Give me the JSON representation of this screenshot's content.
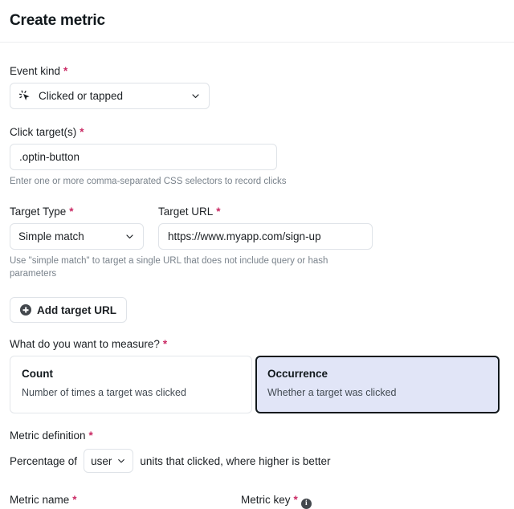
{
  "header": {
    "title": "Create metric"
  },
  "colors": {
    "required_asterisk": "#ca2a64",
    "selected_card_bg": "#e1e5f7",
    "selected_card_border": "#11181c",
    "border": "#dfe3e8",
    "text": "#1c2024",
    "helper_text": "#7a838c"
  },
  "fields": {
    "event_kind": {
      "label": "Event kind",
      "required": "*",
      "value": "Clicked or tapped",
      "icon": "click-cursor-icon",
      "chevron": "chevron-down-icon"
    },
    "click_targets": {
      "label": "Click target(s)",
      "required": "*",
      "value": ".optin-button",
      "placeholder": ".optin-button",
      "helper": "Enter one or more comma-separated CSS selectors to record clicks"
    },
    "target_type": {
      "label": "Target Type",
      "required": "*",
      "value": "Simple match",
      "chevron": "chevron-down-icon"
    },
    "target_url": {
      "label": "Target URL",
      "required": "*",
      "value": "https://www.myapp.com/sign-up",
      "placeholder": "https://www.myapp.com/sign-up"
    },
    "target_helper": "Use \"simple match\" to target a single URL that does not include query or hash parameters",
    "add_target_url": {
      "label": "Add target URL",
      "icon": "plus-circle-icon"
    },
    "measure": {
      "label": "What do you want to measure?",
      "required": "*",
      "options": [
        {
          "title": "Count",
          "description": "Number of times a target was clicked",
          "selected": false
        },
        {
          "title": "Occurrence",
          "description": "Whether a target was clicked",
          "selected": true
        }
      ]
    },
    "metric_definition": {
      "label": "Metric definition",
      "required": "*",
      "prefix": "Percentage of",
      "unit_value": "user",
      "unit_chevron": "chevron-down-icon",
      "suffix": "units that clicked, where higher is better"
    },
    "metric_name": {
      "label": "Metric name",
      "required": "*"
    },
    "metric_key": {
      "label": "Metric key",
      "required": "*",
      "info_icon": "info-icon",
      "info_glyph": "i"
    }
  }
}
